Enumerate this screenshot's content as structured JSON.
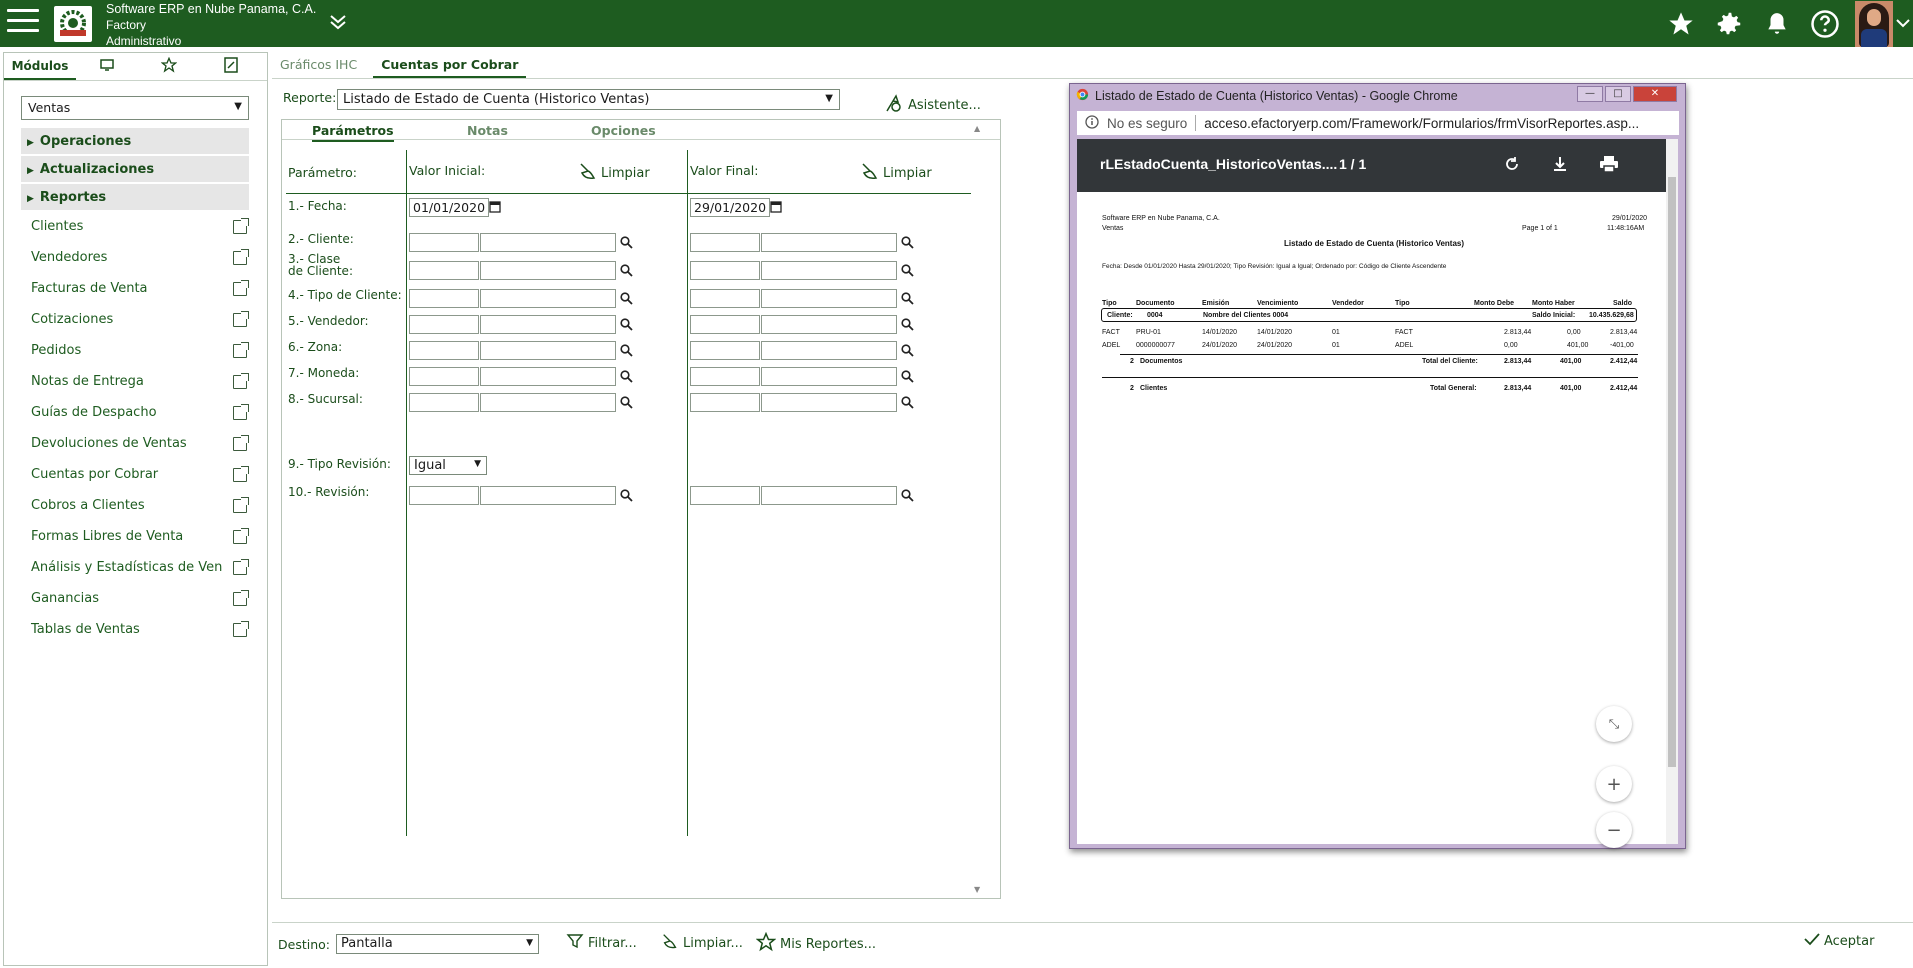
{
  "header": {
    "company_line1": "Software ERP en Nube Panama, C.A.",
    "company_line2": "Factory",
    "company_line3": "Administrativo",
    "icons": [
      "menu-icon",
      "collapse-chevrons-icon",
      "star-icon",
      "gear-icon",
      "bell-icon",
      "help-icon",
      "avatar",
      "chevron-down-icon"
    ]
  },
  "sidebar": {
    "tab_modulos": "Módulos",
    "module_selected": "Ventas",
    "sections": [
      "Operaciones",
      "Actualizaciones",
      "Reportes"
    ],
    "items": [
      {
        "label": "Clientes"
      },
      {
        "label": "Vendedores"
      },
      {
        "label": "Facturas de Venta"
      },
      {
        "label": "Cotizaciones"
      },
      {
        "label": "Pedidos"
      },
      {
        "label": "Notas de Entrega"
      },
      {
        "label": "Guías de Despacho"
      },
      {
        "label": "Devoluciones de Ventas"
      },
      {
        "label": "Cuentas por Cobrar"
      },
      {
        "label": "Cobros a Clientes"
      },
      {
        "label": "Formas Libres de Venta"
      },
      {
        "label": "Análisis y Estadísticas de Ven"
      },
      {
        "label": "Ganancias"
      },
      {
        "label": "Tablas de Ventas"
      }
    ]
  },
  "main": {
    "tabs": [
      "Gráficos IHC",
      "Cuentas por Cobrar"
    ],
    "reporte_label": "Reporte:",
    "reporte_value": "Listado de Estado de Cuenta (Historico Ventas)",
    "asistente": "Asistente...",
    "panel_tabs": [
      "Parámetros",
      "Notas",
      "Opciones"
    ],
    "param_header": "Parámetro:",
    "valor_inicial": "Valor Inicial:",
    "valor_final": "Valor Final:",
    "limpiar": "Limpiar",
    "params": [
      "1.- Fecha:",
      "2.- Cliente:",
      "3.- Clase de Cliente:",
      "4.- Tipo de Cliente:",
      "5.- Vendedor:",
      "6.- Zona:",
      "7.- Moneda:",
      "8.- Sucursal:",
      "9.- Tipo Revisión:",
      "10.- Revisión:"
    ],
    "fecha_inicial": "01/01/2020",
    "fecha_final": "29/01/2020",
    "tipo_revision": "Igual"
  },
  "chrome": {
    "title": "Listado de Estado de Cuenta (Historico Ventas) - Google Chrome",
    "not_secure": "No es seguro",
    "url": "acceso.efactoryerp.com/Framework/Formularios/frmVisorReportes.asp...",
    "pdf_name": "rLEstadoCuenta_HistoricoVentas....",
    "pdf_pages": "1 / 1"
  },
  "report": {
    "company": "Software ERP en Nube Panama, C.A.",
    "module": "Ventas",
    "date": "29/01/2020",
    "page": "Page 1 of 1",
    "time": "11:48:16AM",
    "title": "Listado de Estado de Cuenta (Historico Ventas)",
    "filter": "Fecha: Desde 01/01/2020  Hasta 29/01/2020; Tipo Revisión: Igual a Igual; Ordenado por: Código de Cliente Ascendente",
    "columns": [
      "Tipo",
      "Documento",
      "Emisión",
      "Vencimiento",
      "Vendedor",
      "Tipo",
      "Monto Debe",
      "Monto Haber",
      "Saldo"
    ],
    "cliente_label": "Cliente:",
    "cliente_code": "0004",
    "cliente_name": "Nombre del Clientes 0004",
    "saldo_inicial_label": "Saldo Inicial:",
    "saldo_inicial": "10.435.629,68",
    "rows": [
      [
        "FACT",
        "PRU-01",
        "14/01/2020",
        "14/01/2020",
        "01",
        "FACT",
        "2.813,44",
        "0,00",
        "2.813,44"
      ],
      [
        "ADEL",
        "0000000077",
        "24/01/2020",
        "24/01/2020",
        "01",
        "ADEL",
        "0,00",
        "401,00",
        "-401,00"
      ]
    ],
    "total_cliente": {
      "count": "2",
      "label1": "Documentos",
      "label2": "Total del Cliente:",
      "debe": "2.813,44",
      "haber": "401,00",
      "saldo": "2.412,44"
    },
    "total_general": {
      "count": "2",
      "label1": "Clientes",
      "label2": "Total General:",
      "debe": "2.813,44",
      "haber": "401,00",
      "saldo": "2.412,44"
    }
  },
  "bottom": {
    "destino_label": "Destino:",
    "destino_value": "Pantalla",
    "filtrar": "Filtrar...",
    "limpiar": "Limpiar...",
    "mis_reportes": "Mis Reportes...",
    "aceptar": "Aceptar"
  }
}
